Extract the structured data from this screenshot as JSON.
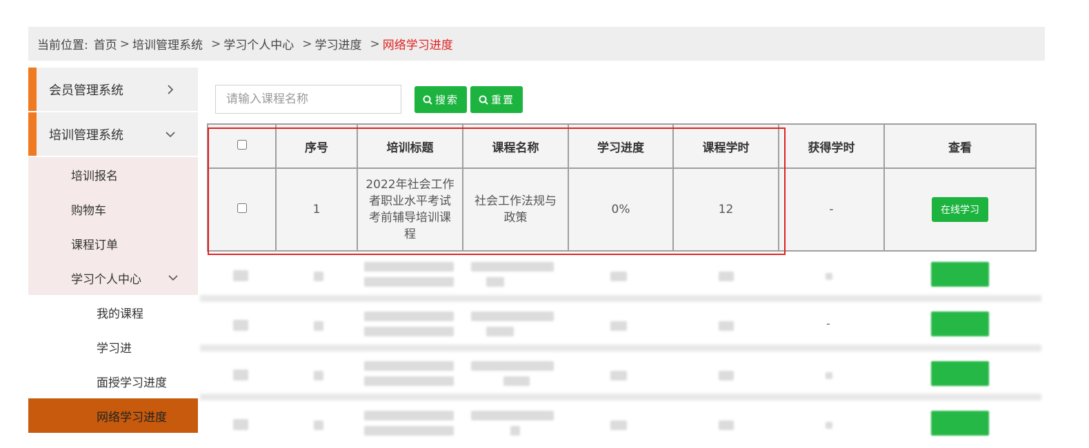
{
  "breadcrumb": {
    "prefix": "当前位置:",
    "items": [
      "首页",
      "培训管理系统",
      "学习个人中心",
      "学习进度"
    ],
    "current": "网络学习进度"
  },
  "sidebar": {
    "menu": [
      {
        "label": "会员管理系统",
        "expanded": false
      },
      {
        "label": "培训管理系统",
        "expanded": true
      }
    ],
    "sub_items": [
      "培训报名",
      "购物车",
      "课程订单",
      "学习个人中心"
    ],
    "subsub_items": [
      "我的课程",
      "学习进",
      "面授学习进度",
      "网络学习进度"
    ],
    "active": "网络学习进度"
  },
  "search": {
    "placeholder": "请输入课程名称",
    "search_label": "搜索",
    "reset_label": "重置"
  },
  "table": {
    "headers": [
      "",
      "序号",
      "培训标题",
      "课程名称",
      "学习进度",
      "课程学时",
      "获得学时",
      "查看"
    ],
    "rows": [
      {
        "index": "1",
        "title": "2022年社会工作者职业水平考试考前辅导培训课程",
        "course": "社会工作法规与政策",
        "progress": "0%",
        "hours": "12",
        "earned": "-",
        "action": "在线学习"
      }
    ],
    "blurred_dash": "-"
  },
  "colors": {
    "accent_orange": "#f07a22",
    "active_bg": "#c75a0c",
    "button_green": "#1db33f",
    "highlight_red": "#e02020"
  }
}
